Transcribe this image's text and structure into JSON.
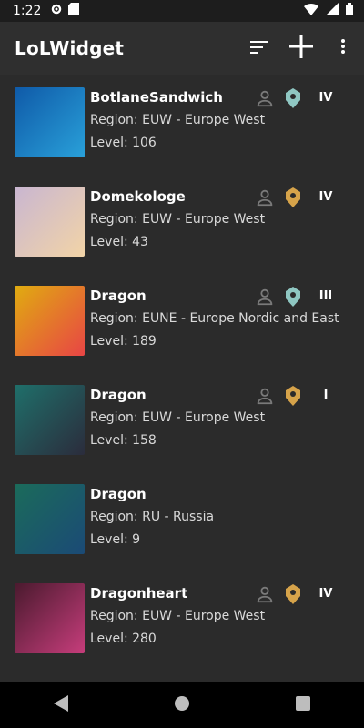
{
  "status": {
    "time": "1:22"
  },
  "app": {
    "title": "LoLWidget",
    "actions": [
      {
        "icon": "sort-icon"
      },
      {
        "icon": "plus-icon"
      },
      {
        "icon": "more-vert-icon"
      }
    ]
  },
  "players": [
    {
      "name": "BotlaneSandwich",
      "region": "Region: EUW - Europe West",
      "level": "Level: 106",
      "tier": "IV",
      "rank_color": "#8fc7c2",
      "avatar_colors": [
        "#0f5aa8",
        "#29a0d9"
      ]
    },
    {
      "name": "Domekologe",
      "region": "Region: EUW - Europe West",
      "level": "Level: 43",
      "tier": "IV",
      "rank_color": "#d6a34a",
      "avatar_colors": [
        "#c9b6d1",
        "#f2d4a7"
      ]
    },
    {
      "name": "Dragon",
      "region": "Region: EUNE - Europe Nordic and East",
      "level": "Level: 189",
      "tier": "III",
      "rank_color": "#8fc7c2",
      "avatar_colors": [
        "#e0ac10",
        "#e84545"
      ]
    },
    {
      "name": "Dragon",
      "region": "Region: EUW - Europe West",
      "level": "Level: 158",
      "tier": "I",
      "rank_color": "#d6a34a",
      "avatar_colors": [
        "#1f6f6a",
        "#2b2c3c"
      ]
    },
    {
      "name": "Dragon",
      "region": "Region: RU - Russia",
      "level": "Level: 9",
      "tier": "",
      "rank_color": "",
      "avatar_colors": [
        "#1b6b5a",
        "#1b4a76"
      ]
    },
    {
      "name": "Dragonheart",
      "region": "Region: EUW - Europe West",
      "level": "Level: 280",
      "tier": "IV",
      "rank_color": "#d6a34a",
      "avatar_colors": [
        "#4a1a2e",
        "#c63d7b"
      ]
    }
  ],
  "nav": {
    "back": "back-icon",
    "home": "home-icon",
    "recents": "recents-icon"
  }
}
